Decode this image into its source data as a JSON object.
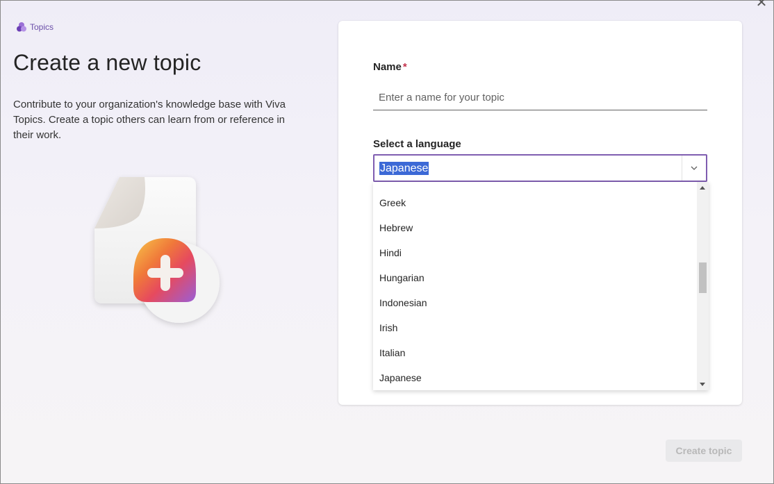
{
  "app": {
    "tag_label": "Topics",
    "icon": "viva-topics-logo-icon"
  },
  "header": {
    "title": "Create a new topic",
    "description": "Contribute to your organization's knowledge base with Viva Topics. Create a topic others can learn from or reference in their work."
  },
  "form": {
    "name_label": "Name",
    "required_marker": "*",
    "name_placeholder": "Enter a name for your topic",
    "name_value": "",
    "language_label": "Select a language",
    "language_selected": "Japanese",
    "language_options_visible": [
      "Greek",
      "Hebrew",
      "Hindi",
      "Hungarian",
      "Indonesian",
      "Irish",
      "Italian",
      "Japanese"
    ]
  },
  "footer": {
    "create_label": "Create topic"
  },
  "colors": {
    "accent": "#7f5db0",
    "selection": "#3c69d6",
    "required": "#c4314b"
  }
}
